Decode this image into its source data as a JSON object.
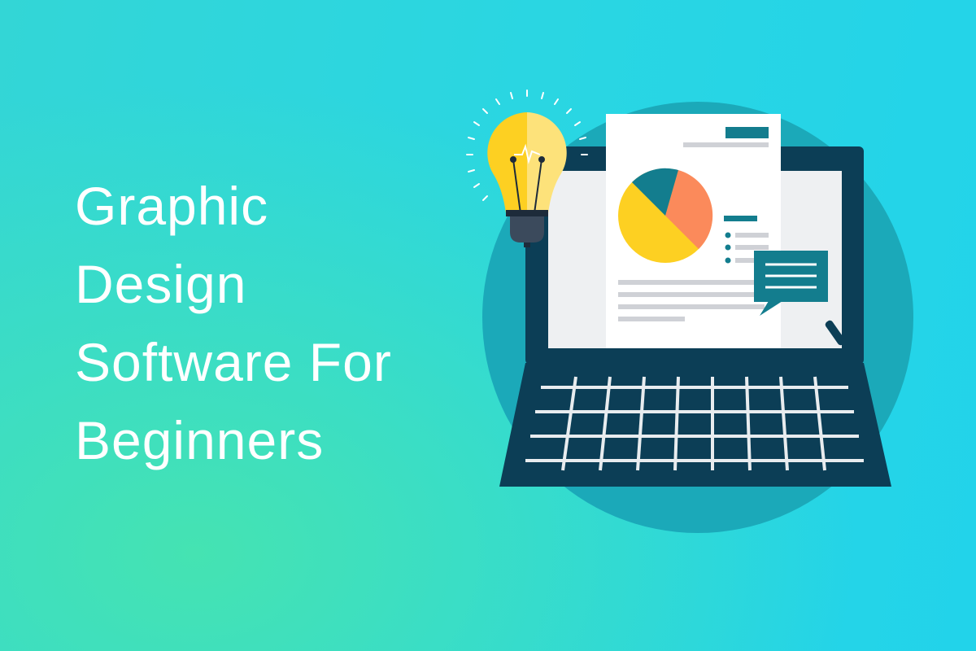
{
  "headline": {
    "lines": [
      "Graphic",
      "Design",
      "Software For",
      "Beginners"
    ]
  },
  "illustration": {
    "subject": "laptop-with-document-pie-chart-and-lightbulb",
    "colors": {
      "laptop": "#0c3e56",
      "circle": "#1ba9b9",
      "screen": "#eef0f2",
      "paper": "#ffffff",
      "accent": "#137d8e",
      "pie_yellow": "#fdd022",
      "pie_orange": "#fb8a5b",
      "pie_teal": "#137d8e",
      "bulb": "#fdd44a",
      "gray_line": "#cfd1d6"
    }
  }
}
